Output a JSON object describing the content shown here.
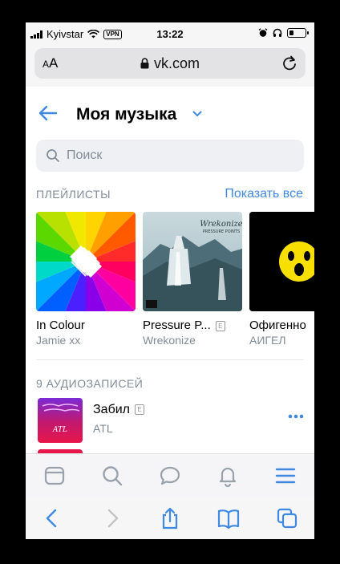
{
  "status_bar": {
    "carrier": "Kyivstar",
    "vpn": "VPN",
    "time": "13:22"
  },
  "browser": {
    "text_size_label": "AA",
    "url": "vk.com"
  },
  "header": {
    "title": "Моя музыка"
  },
  "search": {
    "placeholder": "Поиск"
  },
  "playlists_section": {
    "heading": "ПЛЕЙЛИСТЫ",
    "show_all": "Показать все"
  },
  "playlists": [
    {
      "name": "In Colour",
      "artist": "Jamie xx",
      "explicit": false
    },
    {
      "name": "Pressure P...",
      "artist": "Wrekonize",
      "explicit": true
    },
    {
      "name": "Офигенно",
      "artist": "АИГЕЛ",
      "explicit": false
    }
  ],
  "tracks_section": {
    "heading": "9 АУДИОЗАПИСЕЙ"
  },
  "tracks": [
    {
      "name": "Забил",
      "artist": "ATL",
      "explicit": true
    }
  ],
  "explicit_mark": "E",
  "colors": {
    "accent": "#3f8ae0",
    "secondary_text": "#818c99",
    "icon": "#99a2ad"
  },
  "icons": {
    "tab_bar": [
      "home-icon",
      "search-icon",
      "messages-icon",
      "bell-icon",
      "menu-icon"
    ],
    "safari_bar": [
      "back-icon",
      "forward-icon",
      "share-icon",
      "bookmarks-icon",
      "tabs-icon"
    ]
  }
}
